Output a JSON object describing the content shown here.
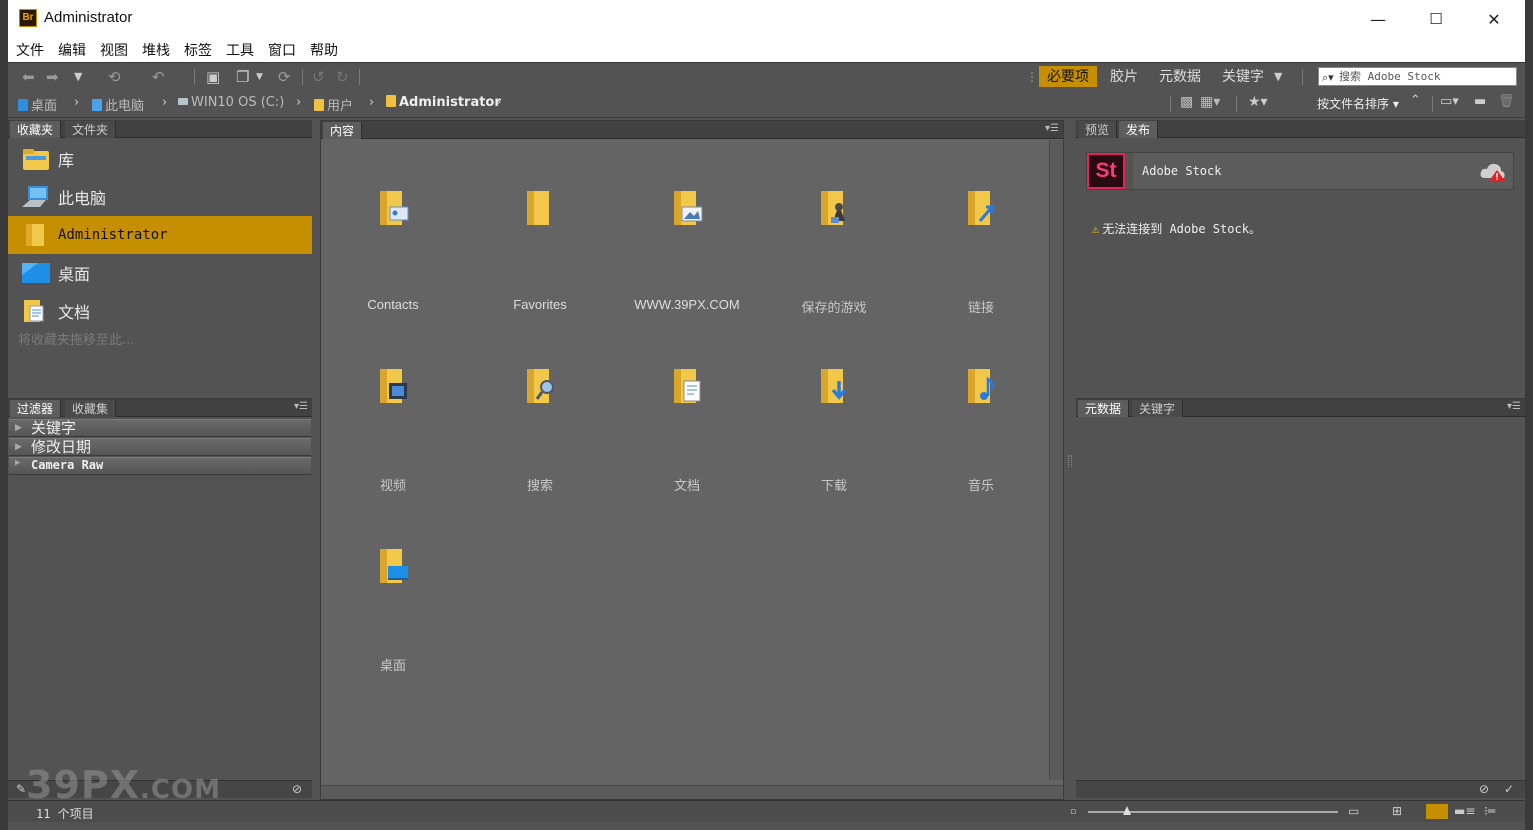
{
  "window": {
    "title": "Administrator",
    "app_icon": "Br",
    "minimize": "—",
    "maximize": "☐",
    "close": "✕"
  },
  "menu": [
    "文件",
    "编辑",
    "视图",
    "堆栈",
    "标签",
    "工具",
    "窗口",
    "帮助"
  ],
  "workspaces": {
    "active": "必要项",
    "items": [
      "胶片",
      "元数据",
      "关键字"
    ]
  },
  "search": {
    "placeholder": "搜索 Adobe Stock"
  },
  "breadcrumb": [
    "桌面",
    "此电脑",
    "WIN10 OS (C:)",
    "用户",
    "Administrator"
  ],
  "sort": {
    "label": "按文件名排序"
  },
  "left_tabs": {
    "favorites": "收藏夹",
    "folders": "文件夹",
    "filter": "过滤器",
    "collections": "收藏集"
  },
  "favorites": [
    {
      "label": "库",
      "icon": "library-folder-icon"
    },
    {
      "label": "此电脑",
      "icon": "computer-icon"
    },
    {
      "label": "Administrator",
      "icon": "user-folder-icon",
      "selected": true
    },
    {
      "label": "桌面",
      "icon": "desktop-icon"
    },
    {
      "label": "文档",
      "icon": "documents-icon"
    }
  ],
  "favorites_hint": "将收藏夹拖移至此...",
  "filters": [
    "关键字",
    "修改日期",
    "Camera Raw"
  ],
  "content": {
    "tab": "内容",
    "items": [
      {
        "label": "Contacts",
        "icon": "contacts-folder-icon"
      },
      {
        "label": "Favorites",
        "icon": "favorites-folder-icon"
      },
      {
        "label": "WWW.39PX.COM",
        "icon": "image-folder-icon"
      },
      {
        "label": "保存的游戏",
        "icon": "saved-games-folder-icon"
      },
      {
        "label": "链接",
        "icon": "links-folder-icon"
      },
      {
        "label": "视频",
        "icon": "videos-folder-icon"
      },
      {
        "label": "搜索",
        "icon": "searches-folder-icon"
      },
      {
        "label": "文档",
        "icon": "documents-folder-icon"
      },
      {
        "label": "下载",
        "icon": "downloads-folder-icon"
      },
      {
        "label": "音乐",
        "icon": "music-folder-icon"
      },
      {
        "label": "桌面",
        "icon": "desktop-folder-icon"
      }
    ]
  },
  "right_tabs": {
    "preview": "预览",
    "publish": "发布",
    "metadata": "元数据",
    "keywords": "关键字"
  },
  "stock": {
    "logo": "St",
    "title": "Adobe Stock",
    "warning": "无法连接到 Adobe Stock。"
  },
  "status": {
    "count": "11 个项目"
  },
  "watermark": {
    "main": "39PX",
    "suffix": ".COM"
  },
  "colors": {
    "accent": "#c68f00",
    "panel": "#535353",
    "content_bg": "#646464",
    "folder": "#f0c040"
  }
}
